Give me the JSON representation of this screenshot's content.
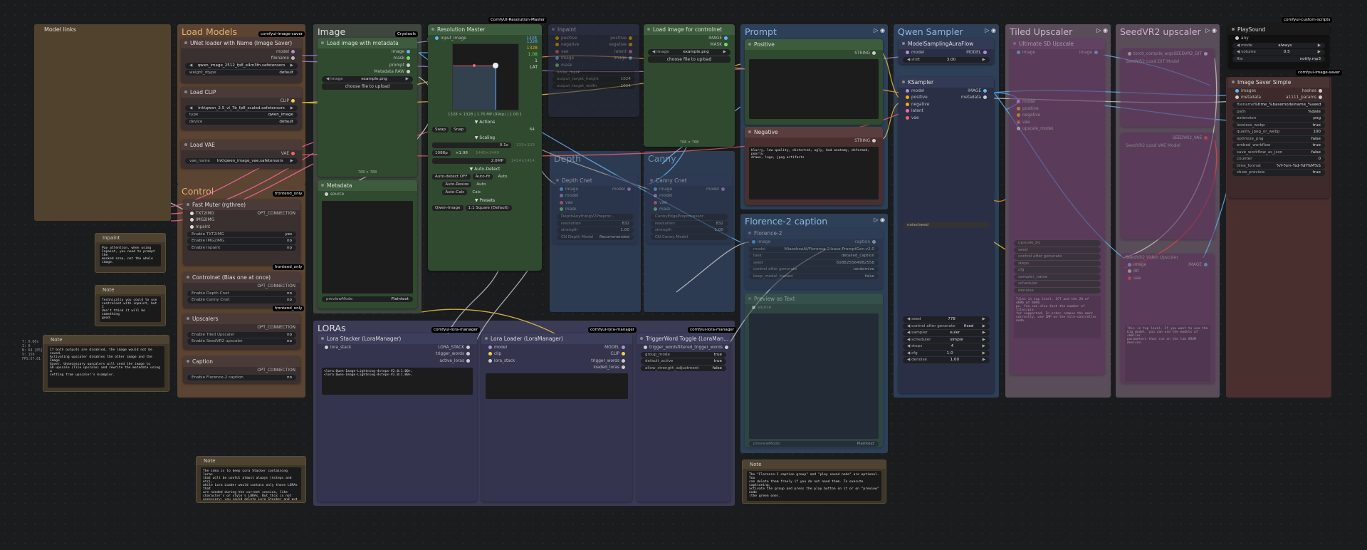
{
  "colors": {
    "load_models": "#5a4430",
    "control": "#5a4430",
    "image": "#3d4a3d",
    "lora": "#3a3a55",
    "prompt": "#2c3e56",
    "sampler": "#2c3e56",
    "tiled": "#5e4f5e",
    "seedvr": "#5e4f5e"
  },
  "groups": {
    "model_links": "Model links",
    "load_models": "Load Models",
    "control": "Control",
    "image": "Image",
    "lora": "LORAs",
    "prompt": "Prompt",
    "sampler": "Qwen Sampler",
    "tiled": "Tiled Upscaler",
    "seedvr": "SeedVR2 upscaler",
    "florence": "Florence-2 caption",
    "depth": "Depth",
    "canny": "Canny"
  },
  "badges": {
    "image_saver": "comfyui-image-saver",
    "frontend": "frontend_only",
    "crystools": "Crystools",
    "res_master": "ComfyUI-Resolution-Master",
    "lora_mgr": "comfyui-lora-manager",
    "custom_scripts": "comfyui-custom-scripts"
  },
  "stats": {
    "l1": "T: 0.00s",
    "l2": "I: 0",
    "l3": "N: 64 [65]",
    "l4": "V: 156",
    "l5": "FPS:57.01"
  },
  "unet": {
    "title": "UNet loader with Name (Image Saver)",
    "out1": "model",
    "out2": "filename",
    "name": "qwen_image_2512_fp8_e4m3fn.safetensors",
    "dtype_label": "weight_dtype",
    "dtype": "default"
  },
  "clip": {
    "title": "Load CLIP",
    "out": "CLIP",
    "name": "lnk\\qwen_2.5_vl_7b_fp8_scaled.safetensors",
    "type_label": "type",
    "type": "qwen_image",
    "device_label": "device",
    "device": "default"
  },
  "vae": {
    "title": "Load VAE",
    "out": "VAE",
    "name_label": "vae_name",
    "name": "lnk\\qwen_image_vae.safetensors"
  },
  "fastmuter": {
    "title": "Fast Muter (rgthree)",
    "o1": "OPT_CONNECTION",
    "i1": "TXT2IMG",
    "i2": "IMG2IMG",
    "i3": "Inpaint",
    "t1": "Enable TXT2IMG",
    "v1": "yes",
    "t2": "Enable IMG2IMG",
    "v2": "no",
    "t3": "Enable Inpaint",
    "v3": "no"
  },
  "controlnet": {
    "title": "Controlnet (Bias one at once)",
    "o1": "OPT_CONNECTION",
    "t1": "Enable Depth Cnet",
    "v1": "no",
    "t2": "Enable Canny Cnet",
    "v2": "no"
  },
  "upscalers": {
    "title": "Upscalers",
    "o1": "OPT_CONNECTION",
    "t1": "Enable Tiled Upscaler",
    "v1": "no",
    "t2": "Enable SeedVR2 upscaler",
    "v2": "no"
  },
  "caption": {
    "title": "Caption",
    "o1": "OPT_CONNECTION",
    "t1": "Enable Florence-2 caption",
    "v1": "no"
  },
  "notes": {
    "inpaint_title": "Inpaint",
    "inpaint": "Pay attention, when using\nInpaint, you need to prompt the\nmasked area, not the whole image.",
    "cnet_title": "Note",
    "cnet": "Technically you could to use\ncontrolnet with inpaint, but I\ndon't think it will be something\ngood.",
    "save_title": "Note",
    "save": "If both outputs are disabled, the image would not be saved.\nActivating upscaler disables the other image and the Image\nSaver. Unnecessary upscalers will send the image to\nSD upscale (Tile upscale) and rewrite the metadata using a\nsetting from upscaler's ksampler.",
    "lora_title": "Note",
    "lora": "The idea is to keep Lora Stacker containing loras\nthat will be useful almost always (4steps and etc),\nwhile Lora Loader would contain only those LORAs that\nare needed during the current session, like\ncharacter's or style's LORAs. But this is not\nnecessary; you could delete Lora Stacker and put all\nthe LORAs you need into Lora Loader.",
    "florence_title": "Note",
    "florence": "The \"Florence-2 caption group\" and \"play sound node\" are optional. You\ncan delete them freely if you do not need them. To execute captioning,\nactivate the group and press the play button on it or on \"preview\" node\n(the green one)."
  },
  "loadimg": {
    "title": "Load image with metadata",
    "o1": "image",
    "o2": "mask",
    "o3": "prompt",
    "o4": "Metadata RAW",
    "image_label": "image",
    "image": "example.png",
    "upload": "choose file to upload",
    "size": "768 × 768"
  },
  "metadata": {
    "title": "Metadata",
    "in": "source",
    "mode": "previewMode",
    "mode_val": "Plaintext"
  },
  "resmaster": {
    "title": "Resolution Master",
    "in": "input_image",
    "v1": "1328",
    "v2": "1328",
    "v3": "1.08",
    "v4": "1",
    "v5": "LAT",
    "info": "1328 × 1328  |  1.76 MP (99kp)  |  1.00:1",
    "actions": "▼ Actions",
    "swap": "Swap",
    "snap": "Snap",
    "snap_val": "64",
    "scaling": "▼ Scaling",
    "s1": "0.1x",
    "s1b": "133×133",
    "s2": "1088p",
    "s2v": "×1.98",
    "s2b": "1440×1440",
    "s3": "2.0MP",
    "s3b": "1414×1414",
    "autodetect": "▼ Auto-Detect",
    "ad_btn": "Auto-detect OFF",
    "autofit": "Auto-fit",
    "autoresize": "Auto-Resize",
    "autocalc": "Auto-Calc",
    "auto": "Auto",
    "calc": "Calc",
    "presets": "▼ Presets",
    "preset1": "Qwen-Image",
    "preset2": "1:1 Square (Default)"
  },
  "inpaint": {
    "title": "Inpaint",
    "o1": "positive",
    "o2": "negative",
    "o3": "latent",
    "o4": "image",
    "i1": "positive",
    "i2": "negative",
    "i3": "vae",
    "i4": "image",
    "i5": "mask",
    "l1": "noise_mask",
    "l2": "output_target_height",
    "l2v": "1024",
    "l3": "output_target_width",
    "l3v": "1024"
  },
  "depth": {
    "title": "Depth Cnet",
    "o1": "model",
    "i1": "image",
    "i2": "model",
    "i3": "vae",
    "i4": "mask",
    "w1": "DepthAnythingV2Preproc...",
    "w2": "resolution",
    "w2v": "832",
    "w3": "strength",
    "w3v": "1.00",
    "w4": "CN Depth Model",
    "w4v": "Recommended"
  },
  "canny": {
    "title": "Canny Cnet",
    "o1": "model",
    "i1": "image",
    "i2": "model",
    "i3": "vae",
    "i4": "mask",
    "w1": "CannyEdgePreprocessor",
    "w2": "resolution",
    "w2v": "832",
    "w3": "strength",
    "w3v": "1.00",
    "w4": "CN Canny Model",
    "w4v": ""
  },
  "loadcn": {
    "title": "Load image for controlnet",
    "o1": "IMAGE",
    "o2": "MASK",
    "image_label": "image",
    "image": "example.png",
    "upload": "choose file to upload",
    "size": "768 × 768"
  },
  "positive": {
    "title": "Positive",
    "out": "STRING"
  },
  "negative": {
    "title": "Negative",
    "out": "STRING",
    "text": "blurry, low quality, distorted, ugly, bad anatomy, deformed, poorly\ndrawn, logo, jpeg artifacts"
  },
  "florence2": {
    "title": "Florence-2",
    "in": "image",
    "out": "caption",
    "w1": "model",
    "w1v": "MiaoshouAI/Florence-2-base-PromptGen-v2.0",
    "w2": "task",
    "w2v": "detailed_caption",
    "w3": "seed",
    "w3v": "508825564982558",
    "w4": "control after generate",
    "w4v": "randomize",
    "w5": "keep_model_loaded",
    "w5v": "false",
    "preview": "Preview as Text",
    "preview_in": "source",
    "preview_mode": "previewMode",
    "preview_mode_v": "Plaintext"
  },
  "sampling": {
    "title": "ModelSamplingAuraFlow",
    "in": "model",
    "out": "MODEL",
    "shift": "shift",
    "shift_v": "3.00"
  },
  "ksampler": {
    "title": "KSampler",
    "i1": "model",
    "i2": "positive",
    "i3": "negative",
    "i4": "latent",
    "i5": "vae",
    "o1": "IMAGE",
    "o2": "metadata",
    "wm": "noise/seed",
    "seed": "seed",
    "seed_v": "778",
    "cag": "control after generate",
    "cag_v": "fixed",
    "sampler": "sampler",
    "sampler_v": "euler",
    "sched": "scheduler",
    "sched_v": "simple",
    "steps": "steps",
    "steps_v": "4",
    "cfg": "cfg",
    "cfg_v": "1.0",
    "denoise": "denoise",
    "denoise_v": "1.00"
  },
  "tiled": {
    "title": "Ultimate SD Upscale",
    "i1": "image",
    "o1": "image",
    "inputs": [
      "model",
      "positive",
      "negative",
      "vae",
      "upscale_model"
    ],
    "rows": [
      "upscale_by",
      "seed",
      "control after generate",
      "steps",
      "cfg",
      "sampler_name",
      "scheduler",
      "denoise"
    ],
    "note": "Tiles in top level. ICT and the 20 of 4096 of 4096\npx. You can also test the number of tiles/pix\nfor supported. In order remove the mark\ncorrectly, use 1MP on the tile-controller node."
  },
  "seedvr": {
    "title": "SeedVR2 Load DiT Model",
    "o1": "SEEDVR2_DiT",
    "i1": "torch_compile_args",
    "title2": "SeedVR2 Load VAE Model",
    "o2": "SEEDVR2_VAE",
    "title3": "SeedVR2 Video Upscaler",
    "i3a": "image",
    "i3b": "dit",
    "i3c": "vae",
    "o3": "IMAGE",
    "note": "This is top level. If you want to use the\nbig model, you can use the models of smaller\nparameters that run on the low VRAM devices."
  },
  "lorastack": {
    "title": "Lora Stacker (LoraManager)",
    "in": "lora_stack",
    "o1": "LORA_STACK",
    "o2": "trigger_words",
    "o3": "active_loras",
    "text": "<lora:Qwen-Image-Lightning-4steps-V2.0:1.00>,\n<lora:Qwen-Image-Lightning-4steps-V2.0:1.00>,"
  },
  "loraloader": {
    "title": "Lora Loader (LoraManager)",
    "i1": "model",
    "i2": "clip",
    "i3": "lora_stack",
    "o1": "MODEL",
    "o2": "CLIP",
    "o3": "trigger_words",
    "o4": "loaded_loras"
  },
  "trigger": {
    "title": "TriggerWord Toggle (LoraMan...",
    "in": "trigger_words",
    "out": "filtered_trigger_words",
    "w1": "group_mode",
    "w1v": "true",
    "w2": "default_active",
    "w2v": "true",
    "w3": "allow_strength_adjustment",
    "w3v": "false"
  },
  "playsound": {
    "title": "PlaySound",
    "in": "any",
    "w1": "mode",
    "w1v": "always",
    "w2": "volume",
    "w2v": "0.5",
    "w3": "file",
    "w3v": "notify.mp3"
  },
  "saver": {
    "title": "Image Saver Simple",
    "i1": "images",
    "i2": "metadata",
    "o1": "hashes",
    "o2": "a1111_params",
    "fields": [
      [
        "filename",
        "%time_%basemodelname_%seed"
      ],
      [
        "path",
        "%date"
      ],
      [
        "extension",
        "png"
      ],
      [
        "lossless_webp",
        "true"
      ],
      [
        "quality_jpeg_or_webp",
        "100"
      ],
      [
        "optimize_png",
        "false"
      ],
      [
        "embed_workflow",
        "true"
      ],
      [
        "save_workflow_as_json",
        "false"
      ],
      [
        "counter",
        "0"
      ],
      [
        "time_format",
        "%Y-%m-%d-%H%M%S"
      ],
      [
        "show_preview",
        "true"
      ]
    ]
  }
}
